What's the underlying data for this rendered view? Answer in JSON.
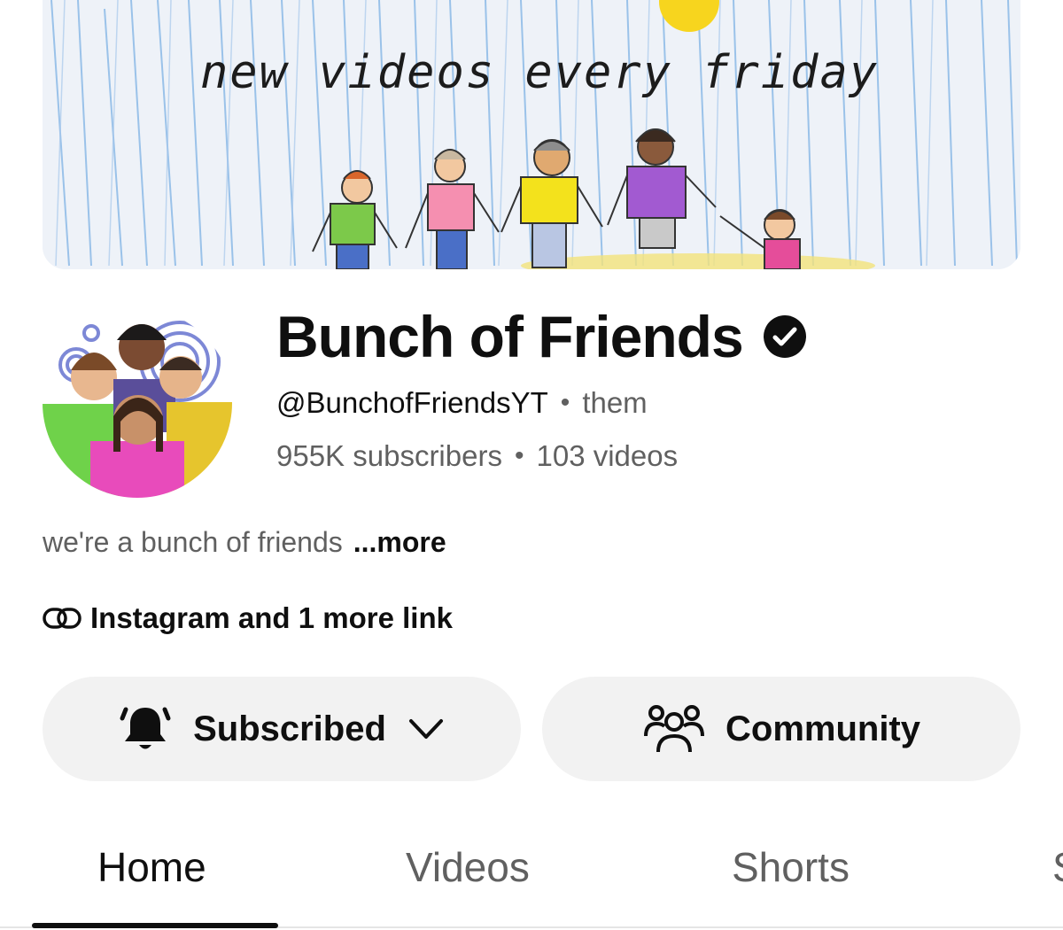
{
  "banner": {
    "text": "new videos every friday"
  },
  "channel": {
    "name": "Bunch of Friends",
    "handle": "@BunchofFriendsYT",
    "pronouns": "them",
    "subscribers": "955K subscribers",
    "videos": "103 videos",
    "separator": "•",
    "description": "we're a bunch of friends",
    "description_more": "...more",
    "links_label": "Instagram and 1 more link"
  },
  "actions": {
    "subscribed_label": "Subscribed",
    "community_label": "Community"
  },
  "tabs": [
    {
      "label": "Home",
      "active": true
    },
    {
      "label": "Videos",
      "active": false
    },
    {
      "label": "Shorts",
      "active": false
    },
    {
      "label": "S",
      "active": false
    }
  ],
  "icons": {
    "verified": "verified-check-icon",
    "link": "link-icon",
    "bell": "bell-icon",
    "chevron": "chevron-down-icon",
    "community": "community-people-icon"
  },
  "colors": {
    "primary_text": "#0f0f0f",
    "secondary_text": "#606060",
    "button_bg": "#f2f2f2",
    "divider": "#e5e5e5"
  }
}
